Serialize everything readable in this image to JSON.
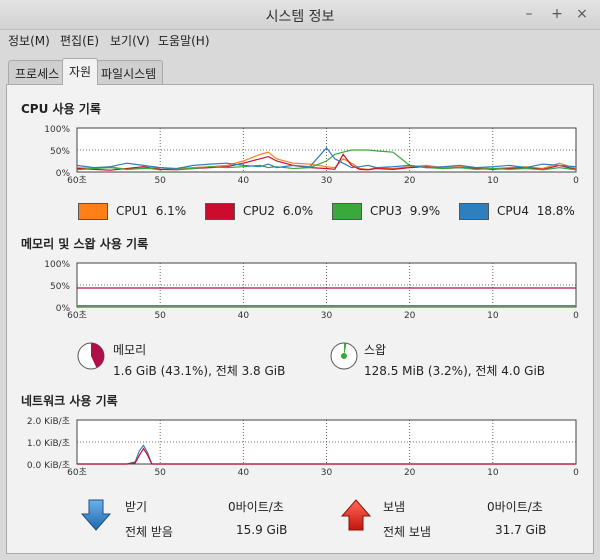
{
  "window": {
    "title": "시스템 정보",
    "minimize": "–",
    "maximize": "+",
    "close": "×"
  },
  "menu": [
    "정보(M)",
    "편집(E)",
    "보기(V)",
    "도움말(H)"
  ],
  "tabs": [
    {
      "label": "프로세스"
    },
    {
      "label": "자원"
    },
    {
      "label": "파일시스템"
    }
  ],
  "cpu": {
    "title": "CPU 사용 기록",
    "y_ticks": [
      "100%",
      "50%",
      "0%"
    ],
    "x_ticks": [
      "60초",
      "50",
      "40",
      "30",
      "20",
      "10",
      "0"
    ],
    "legend": [
      {
        "name": "CPU1",
        "value": "6.1%",
        "color": "#ff7f1a"
      },
      {
        "name": "CPU2",
        "value": "6.0%",
        "color": "#cc0c2f"
      },
      {
        "name": "CPU3",
        "value": "9.9%",
        "color": "#3aa83a"
      },
      {
        "name": "CPU4",
        "value": "18.8%",
        "color": "#2f7fbf"
      }
    ]
  },
  "memory": {
    "title": "메모리 및 스왑 사용 기록",
    "y_ticks": [
      "100%",
      "50%",
      "0%"
    ],
    "x_ticks": [
      "60초",
      "50",
      "40",
      "30",
      "20",
      "10",
      "0"
    ],
    "mem_label": "메모리",
    "mem_value": "1.6 GiB (43.1%), 전체 3.8 GiB",
    "mem_fraction": 0.431,
    "mem_color": "#b0104a",
    "swap_label": "스왑",
    "swap_value": "128.5 MiB (3.2%), 전체 4.0 GiB",
    "swap_fraction": 0.032,
    "swap_color": "#3aa83a"
  },
  "network": {
    "title": "네트워크 사용 기록",
    "y_ticks": [
      "2.0 KiB/초",
      "1.0 KiB/초",
      "0.0 KiB/초"
    ],
    "x_ticks": [
      "60초",
      "50",
      "40",
      "30",
      "20",
      "10",
      "0"
    ],
    "recv_label": "받기",
    "recv_rate": "0바이트/초",
    "recv_total_label": "전체 받음",
    "recv_total": "15.9 GiB",
    "send_label": "보냄",
    "send_rate": "0바이트/초",
    "send_total_label": "전체 보냄",
    "send_total": "31.7 GiB"
  },
  "chart_data": [
    {
      "type": "line",
      "title": "CPU 사용 기록",
      "xlabel": "",
      "ylabel": "",
      "x": [
        60,
        58,
        56,
        54,
        52,
        50,
        48,
        46,
        44,
        42,
        40,
        38,
        37,
        36,
        34,
        32,
        30,
        29,
        28,
        27,
        26,
        25,
        24,
        22,
        20,
        18,
        16,
        14,
        12,
        10,
        8,
        6,
        4,
        2,
        0
      ],
      "xlim": [
        60,
        0
      ],
      "ylim": [
        0,
        100
      ],
      "series": [
        {
          "name": "CPU1",
          "values": [
            10,
            8,
            12,
            6,
            9,
            5,
            8,
            10,
            12,
            15,
            25,
            40,
            45,
            30,
            20,
            18,
            12,
            10,
            30,
            20,
            8,
            6,
            10,
            8,
            12,
            15,
            10,
            12,
            10,
            8,
            10,
            12,
            8,
            20,
            8
          ]
        },
        {
          "name": "CPU2",
          "values": [
            8,
            6,
            4,
            8,
            12,
            6,
            5,
            8,
            10,
            12,
            20,
            30,
            35,
            25,
            15,
            10,
            8,
            6,
            40,
            15,
            6,
            5,
            8,
            6,
            10,
            12,
            8,
            10,
            8,
            6,
            8,
            10,
            6,
            15,
            6
          ]
        },
        {
          "name": "CPU3",
          "values": [
            5,
            8,
            10,
            6,
            8,
            10,
            6,
            8,
            12,
            10,
            12,
            15,
            10,
            12,
            8,
            10,
            25,
            40,
            45,
            50,
            50,
            50,
            48,
            45,
            15,
            10,
            8,
            10,
            6,
            8,
            6,
            8,
            5,
            10,
            5
          ]
        },
        {
          "name": "CPU4",
          "values": [
            15,
            10,
            12,
            20,
            15,
            10,
            8,
            15,
            18,
            20,
            15,
            12,
            18,
            10,
            15,
            12,
            55,
            30,
            20,
            10,
            12,
            15,
            10,
            12,
            15,
            10,
            12,
            15,
            10,
            12,
            15,
            10,
            18,
            15,
            12
          ]
        }
      ]
    },
    {
      "type": "line",
      "title": "메모리 및 스왑 사용 기록",
      "xlabel": "",
      "ylabel": "",
      "x": [
        60,
        0
      ],
      "xlim": [
        60,
        0
      ],
      "ylim": [
        0,
        100
      ],
      "series": [
        {
          "name": "메모리",
          "values": [
            43.1,
            43.1
          ]
        },
        {
          "name": "스왑",
          "values": [
            3.2,
            3.2
          ]
        }
      ]
    },
    {
      "type": "line",
      "title": "네트워크 사용 기록",
      "xlabel": "",
      "ylabel": "",
      "x": [
        60,
        54,
        53,
        52.5,
        52,
        51.5,
        51,
        0
      ],
      "xlim": [
        60,
        0
      ],
      "ylim": [
        0,
        2.0
      ],
      "series": [
        {
          "name": "받기",
          "values": [
            0,
            0,
            0.1,
            0.6,
            0.85,
            0.5,
            0,
            0
          ]
        },
        {
          "name": "보냄",
          "values": [
            0,
            0,
            0.05,
            0.4,
            0.7,
            0.4,
            0,
            0
          ]
        }
      ]
    }
  ]
}
